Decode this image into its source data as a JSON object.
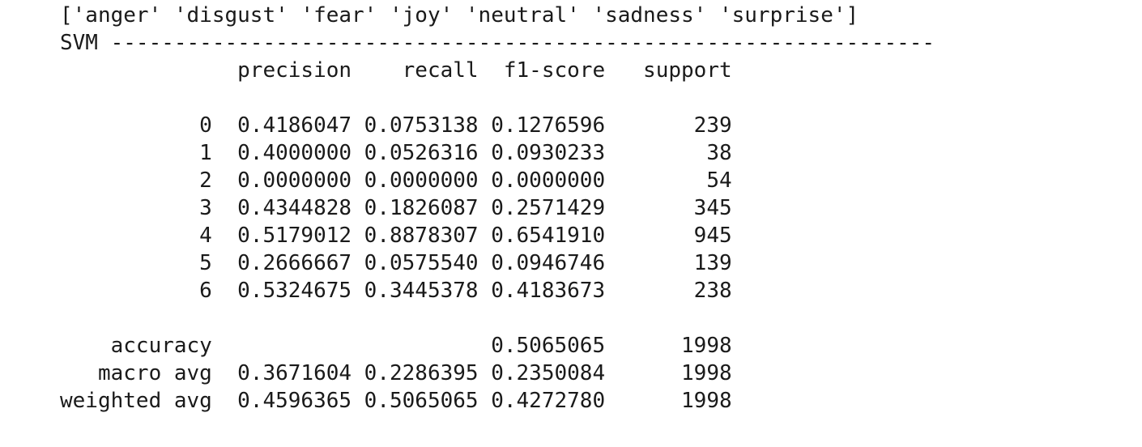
{
  "cell_output": {
    "labels_line": "['anger' 'disgust' 'fear' 'joy' 'neutral' 'sadness' 'surprise']",
    "svm_header": "SVM -----------------------------------------------------------------",
    "report": {
      "columns_header": "              precision    recall  f1-score   support",
      "rows": [
        "           0  0.4186047 0.0753138 0.1276596       239",
        "           1  0.4000000 0.0526316 0.0930233        38",
        "           2  0.0000000 0.0000000 0.0000000        54",
        "           3  0.4344828 0.1826087 0.2571429       345",
        "           4  0.5179012 0.8878307 0.6541910       945",
        "           5  0.2666667 0.0575540 0.0946746       139",
        "           6  0.5324675 0.3445378 0.4183673       238"
      ],
      "accuracy": "    accuracy                      0.5065065      1998",
      "macro_avg": "   macro avg  0.3671604 0.2286395 0.2350084      1998",
      "weighted_avg": "weighted avg  0.4596365 0.5065065 0.4272780      1998"
    }
  }
}
